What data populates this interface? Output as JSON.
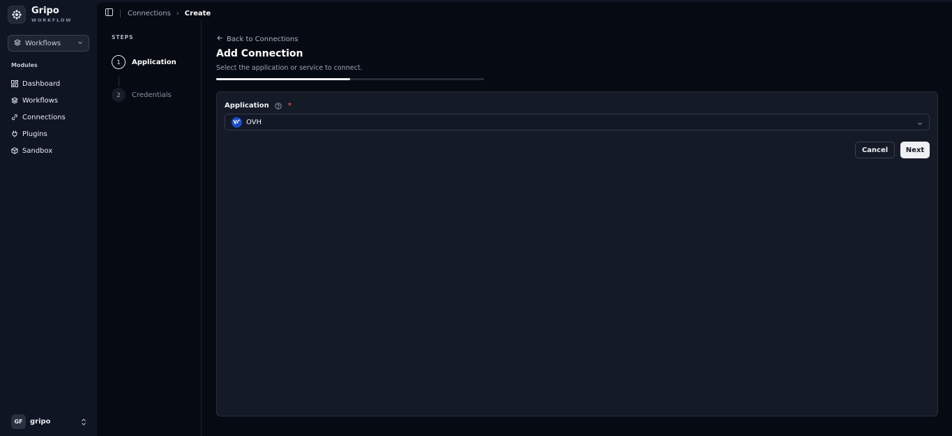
{
  "brand": {
    "name": "Gripo",
    "subtitle": "WORKFLOW",
    "logo_icon": "gear-flower-icon"
  },
  "workspace_select": {
    "label": "Workflows",
    "icon": "layers-icon"
  },
  "sidebar": {
    "section_label": "Modules",
    "items": [
      {
        "label": "Dashboard",
        "icon": "grid-icon"
      },
      {
        "label": "Workflows",
        "icon": "layers-icon"
      },
      {
        "label": "Connections",
        "icon": "link-icon"
      },
      {
        "label": "Plugins",
        "icon": "plug-icon"
      },
      {
        "label": "Sandbox",
        "icon": "box-icon"
      }
    ]
  },
  "user": {
    "initials": "GF",
    "name": "gripo"
  },
  "breadcrumb": {
    "parent": "Connections",
    "current": "Create"
  },
  "steps": {
    "title": "STEPS",
    "items": [
      {
        "number": "1",
        "label": "Application",
        "active": true
      },
      {
        "number": "2",
        "label": "Credentials",
        "active": false
      }
    ]
  },
  "content": {
    "back_link": "Back to Connections",
    "title": "Add Connection",
    "subtitle": "Select the application or service to connect.",
    "progress_percent": 50
  },
  "form": {
    "application_label": "Application",
    "required_marker": "*",
    "application_value": "OVH",
    "cancel_label": "Cancel",
    "next_label": "Next"
  },
  "colors": {
    "background": "#0f1523",
    "main_background": "#060a13",
    "card_background": "#141a26",
    "required": "#e5484d",
    "ovh_logo": "#1a4ec9"
  }
}
